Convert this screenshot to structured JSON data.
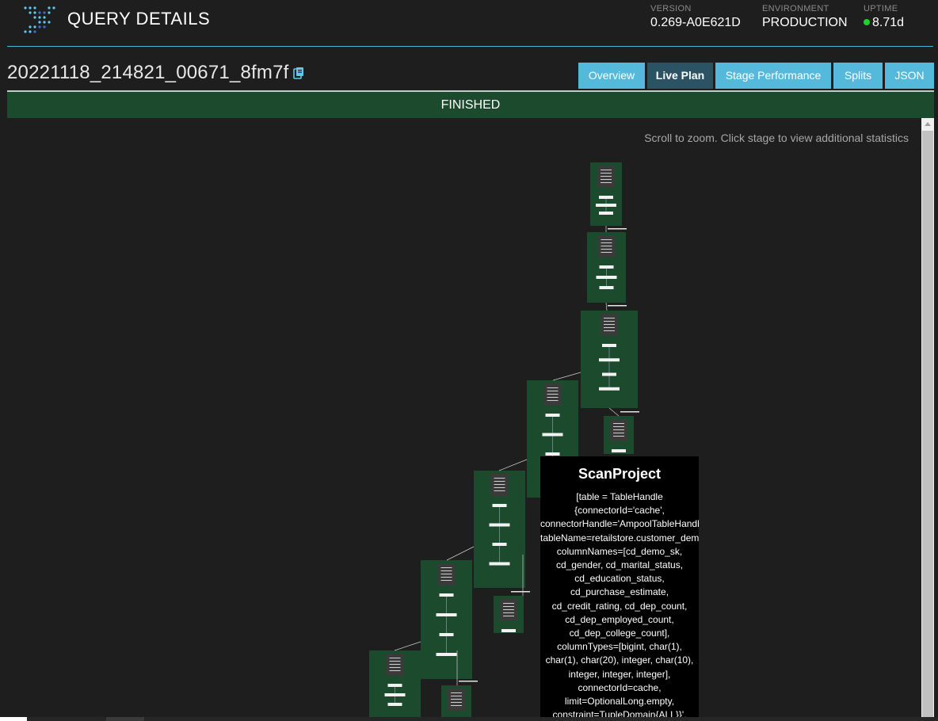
{
  "header": {
    "title": "QUERY DETAILS",
    "version_label": "VERSION",
    "version_value": "0.269-A0E621D",
    "environment_label": "ENVIRONMENT",
    "environment_value": "PRODUCTION",
    "uptime_label": "UPTIME",
    "uptime_value": "8.71d",
    "status_color": "#1fd12a",
    "accent_color": "#4bb7d6"
  },
  "query": {
    "id": "20221118_214821_00671_8fm7f",
    "copy_icon": "clipboard-icon",
    "state": "FINISHED",
    "state_color": "#1b4a2d"
  },
  "tabs": [
    {
      "label": "Overview",
      "active": false
    },
    {
      "label": "Live Plan",
      "active": true
    },
    {
      "label": "Stage Performance",
      "active": false
    },
    {
      "label": "Splits",
      "active": false
    },
    {
      "label": "JSON",
      "active": false
    }
  ],
  "plan": {
    "hint": "Scroll to zoom. Click stage to view additional statistics"
  },
  "tooltip": {
    "title": "ScanProject",
    "body": "[table = TableHandle\n{connectorId='cache',\nconnectorHandle='AmpoolTableHandle{schemaName=retailstore,\ntableName=retailstore.customer_demographics,\ncolumnNames=[cd_demo_sk,\ncd_gender, cd_marital_status,\ncd_education_status,\ncd_purchase_estimate,\ncd_credit_rating, cd_dep_count,\ncd_dep_employed_count,\ncd_dep_college_count],\ncolumnTypes=[bigint, char(1),\nchar(1), char(20), integer, char(10),\ninteger, integer, integer],\nconnectorId=cache,\nlimit=OptionalLong.empty,\nconstraint=TupleDomain{ALL}}',"
  }
}
